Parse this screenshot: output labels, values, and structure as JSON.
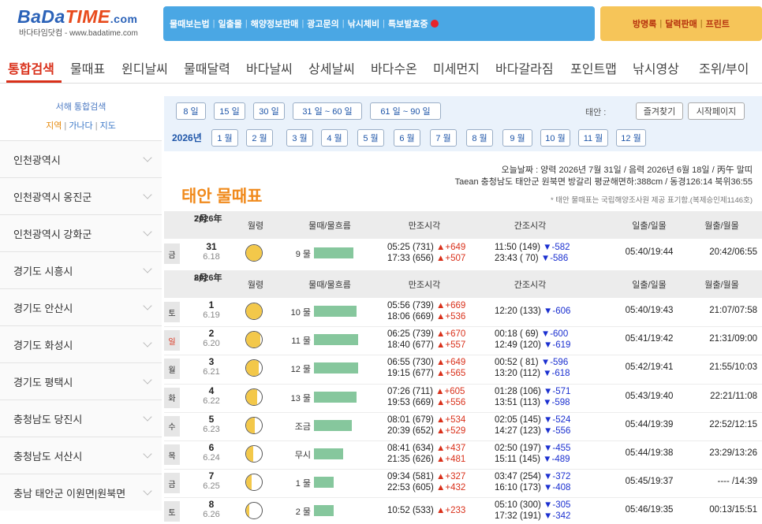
{
  "header": {
    "logo_bada": "BaDa",
    "logo_time": "TIME",
    "logo_com": ".com",
    "logo_sub": "바다타임닷컴 - www.badatime.com",
    "blue_links": [
      "물때보는법",
      "일출몰",
      "해양정보판매",
      "광고문의",
      "낚시체비",
      "특보발효중"
    ],
    "orange_links": [
      "방명록",
      "달력판매",
      "프린트"
    ]
  },
  "nav": [
    "통합검색",
    "물때표",
    "윈디날씨",
    "물때달력",
    "바다날씨",
    "상세날씨",
    "바다수온",
    "미세먼지",
    "바다갈라짐",
    "포인트맵",
    "낚시영상",
    "조위/부이"
  ],
  "sidebar": {
    "search_label": "서해 통합검색",
    "links": [
      "지역",
      "가나다",
      "지도"
    ],
    "items": [
      "인천광역시",
      "인천광역시 옹진군",
      "인천광역시 강화군",
      "경기도 시흥시",
      "경기도 안산시",
      "경기도 화성시",
      "경기도 평택시",
      "충청남도 당진시",
      "충청남도 서산시",
      "충남 태안군 이원면|원북면"
    ]
  },
  "filter": {
    "ranges": [
      "8 일",
      "15 일",
      "30 일",
      "31 일 ~ 60 일",
      "61 일 ~ 90 일"
    ],
    "place_label": "태안 :",
    "actions": [
      "즐겨찾기",
      "시작페이지"
    ],
    "year": "2026년",
    "months": [
      "1 월",
      "2 월",
      "3 월",
      "4 월",
      "5 월",
      "6 월",
      "7 월",
      "8 월",
      "9 월",
      "10 월",
      "11 월",
      "12 월"
    ]
  },
  "info": {
    "today": "오늘날짜 : 양력 2026년 7월 31일 / 음력 2026년 6월 18일 / 丙午 말띠",
    "location": "Taean 충청남도 태안군 원북면 방갈리 평균해면하:388cm / 동경126:14 북위36:55",
    "source": "* 태안 물때표는 국립해양조사원 제공 표기함.(복제승인제1146호)",
    "title": "태안 물때표"
  },
  "columns": [
    "월령",
    "물때/물흐름",
    "만조시각",
    "간조시각",
    "일출/일몰",
    "월출/월몰"
  ],
  "section_july": {
    "year": "2026年",
    "month": "7月"
  },
  "section_aug": {
    "year": "2026年",
    "month": "8月"
  },
  "rows_july": [
    {
      "day": "금",
      "date": "31",
      "lunar": "6.18",
      "moon": 0.96,
      "tide": "9 물",
      "flow": 0.9,
      "high1": "05:25 (731)",
      "hd1": "▲+649",
      "high2": "17:33 (656)",
      "hd2": "▲+507",
      "low1": "11:50 (149)",
      "ld1": "▼-582",
      "low2": "23:43 ( 70)",
      "ld2": "▼-586",
      "sun": "05:40/19:44",
      "moonrise": "20:42/06:55"
    }
  ],
  "rows_aug": [
    {
      "day": "토",
      "date": "1",
      "lunar": "6.19",
      "moon": 0.9,
      "tide": "10 물",
      "flow": 0.96,
      "high1": "05:56 (739)",
      "hd1": "▲+669",
      "high2": "18:06 (669)",
      "hd2": "▲+536",
      "low1": "12:20 (133)",
      "ld1": "▼-606",
      "low2": "",
      "ld2": "",
      "sun": "05:40/19:43",
      "moonrise": "21:07/07:58"
    },
    {
      "day": "일",
      "date": "2",
      "lunar": "6.20",
      "moon": 0.82,
      "tide": "11 물",
      "flow": 1.0,
      "high1": "06:25 (739)",
      "hd1": "▲+670",
      "high2": "18:40 (677)",
      "hd2": "▲+557",
      "low1": "00:18 ( 69)",
      "ld1": "▼-600",
      "low2": "12:49 (120)",
      "ld2": "▼-619",
      "sun": "05:41/19:42",
      "moonrise": "21:31/09:00"
    },
    {
      "day": "월",
      "date": "3",
      "lunar": "6.21",
      "moon": 0.72,
      "tide": "12 물",
      "flow": 1.0,
      "high1": "06:55 (730)",
      "hd1": "▲+649",
      "high2": "19:15 (677)",
      "hd2": "▲+565",
      "low1": "00:52 ( 81)",
      "ld1": "▼-596",
      "low2": "13:20 (112)",
      "ld2": "▼-618",
      "sun": "05:42/19:41",
      "moonrise": "21:55/10:03"
    },
    {
      "day": "화",
      "date": "4",
      "lunar": "6.22",
      "moon": 0.62,
      "tide": "13 물",
      "flow": 0.96,
      "high1": "07:26 (711)",
      "hd1": "▲+605",
      "high2": "19:53 (669)",
      "hd2": "▲+556",
      "low1": "01:28 (106)",
      "ld1": "▼-571",
      "low2": "13:51 (113)",
      "ld2": "▼-598",
      "sun": "05:43/19:40",
      "moonrise": "22:21/11:08"
    },
    {
      "day": "수",
      "date": "5",
      "lunar": "6.23",
      "moon": 0.5,
      "tide": "조금",
      "flow": 0.86,
      "high1": "08:01 (679)",
      "hd1": "▲+534",
      "high2": "20:39 (652)",
      "hd2": "▲+529",
      "low1": "02:05 (145)",
      "ld1": "▼-524",
      "low2": "14:27 (123)",
      "ld2": "▼-556",
      "sun": "05:44/19:39",
      "moonrise": "22:52/12:15"
    },
    {
      "day": "목",
      "date": "6",
      "lunar": "6.24",
      "moon": 0.42,
      "tide": "무시",
      "flow": 0.66,
      "high1": "08:41 (634)",
      "hd1": "▲+437",
      "high2": "21:35 (626)",
      "hd2": "▲+481",
      "low1": "02:50 (197)",
      "ld1": "▼-455",
      "low2": "15:11 (145)",
      "ld2": "▼-489",
      "sun": "05:44/19:38",
      "moonrise": "23:29/13:26"
    },
    {
      "day": "금",
      "date": "7",
      "lunar": "6.25",
      "moon": 0.3,
      "tide": "1 물",
      "flow": 0.44,
      "high1": "09:34 (581)",
      "hd1": "▲+327",
      "high2": "22:53 (605)",
      "hd2": "▲+432",
      "low1": "03:47 (254)",
      "ld1": "▼-372",
      "low2": "16:10 (173)",
      "ld2": "▼-408",
      "sun": "05:45/19:37",
      "moonrise": "---- /14:39"
    },
    {
      "day": "토",
      "date": "8",
      "lunar": "6.26",
      "moon": 0.18,
      "tide": "2 물",
      "flow": 0.44,
      "high1": "10:52 (533)",
      "hd1": "▲+233",
      "high2": "",
      "hd2": "",
      "low1": "05:10 (300)",
      "ld1": "▼-305",
      "low2": "17:32 (191)",
      "ld2": "▼-342",
      "sun": "05:46/19:35",
      "moonrise": "00:13/15:51"
    }
  ]
}
